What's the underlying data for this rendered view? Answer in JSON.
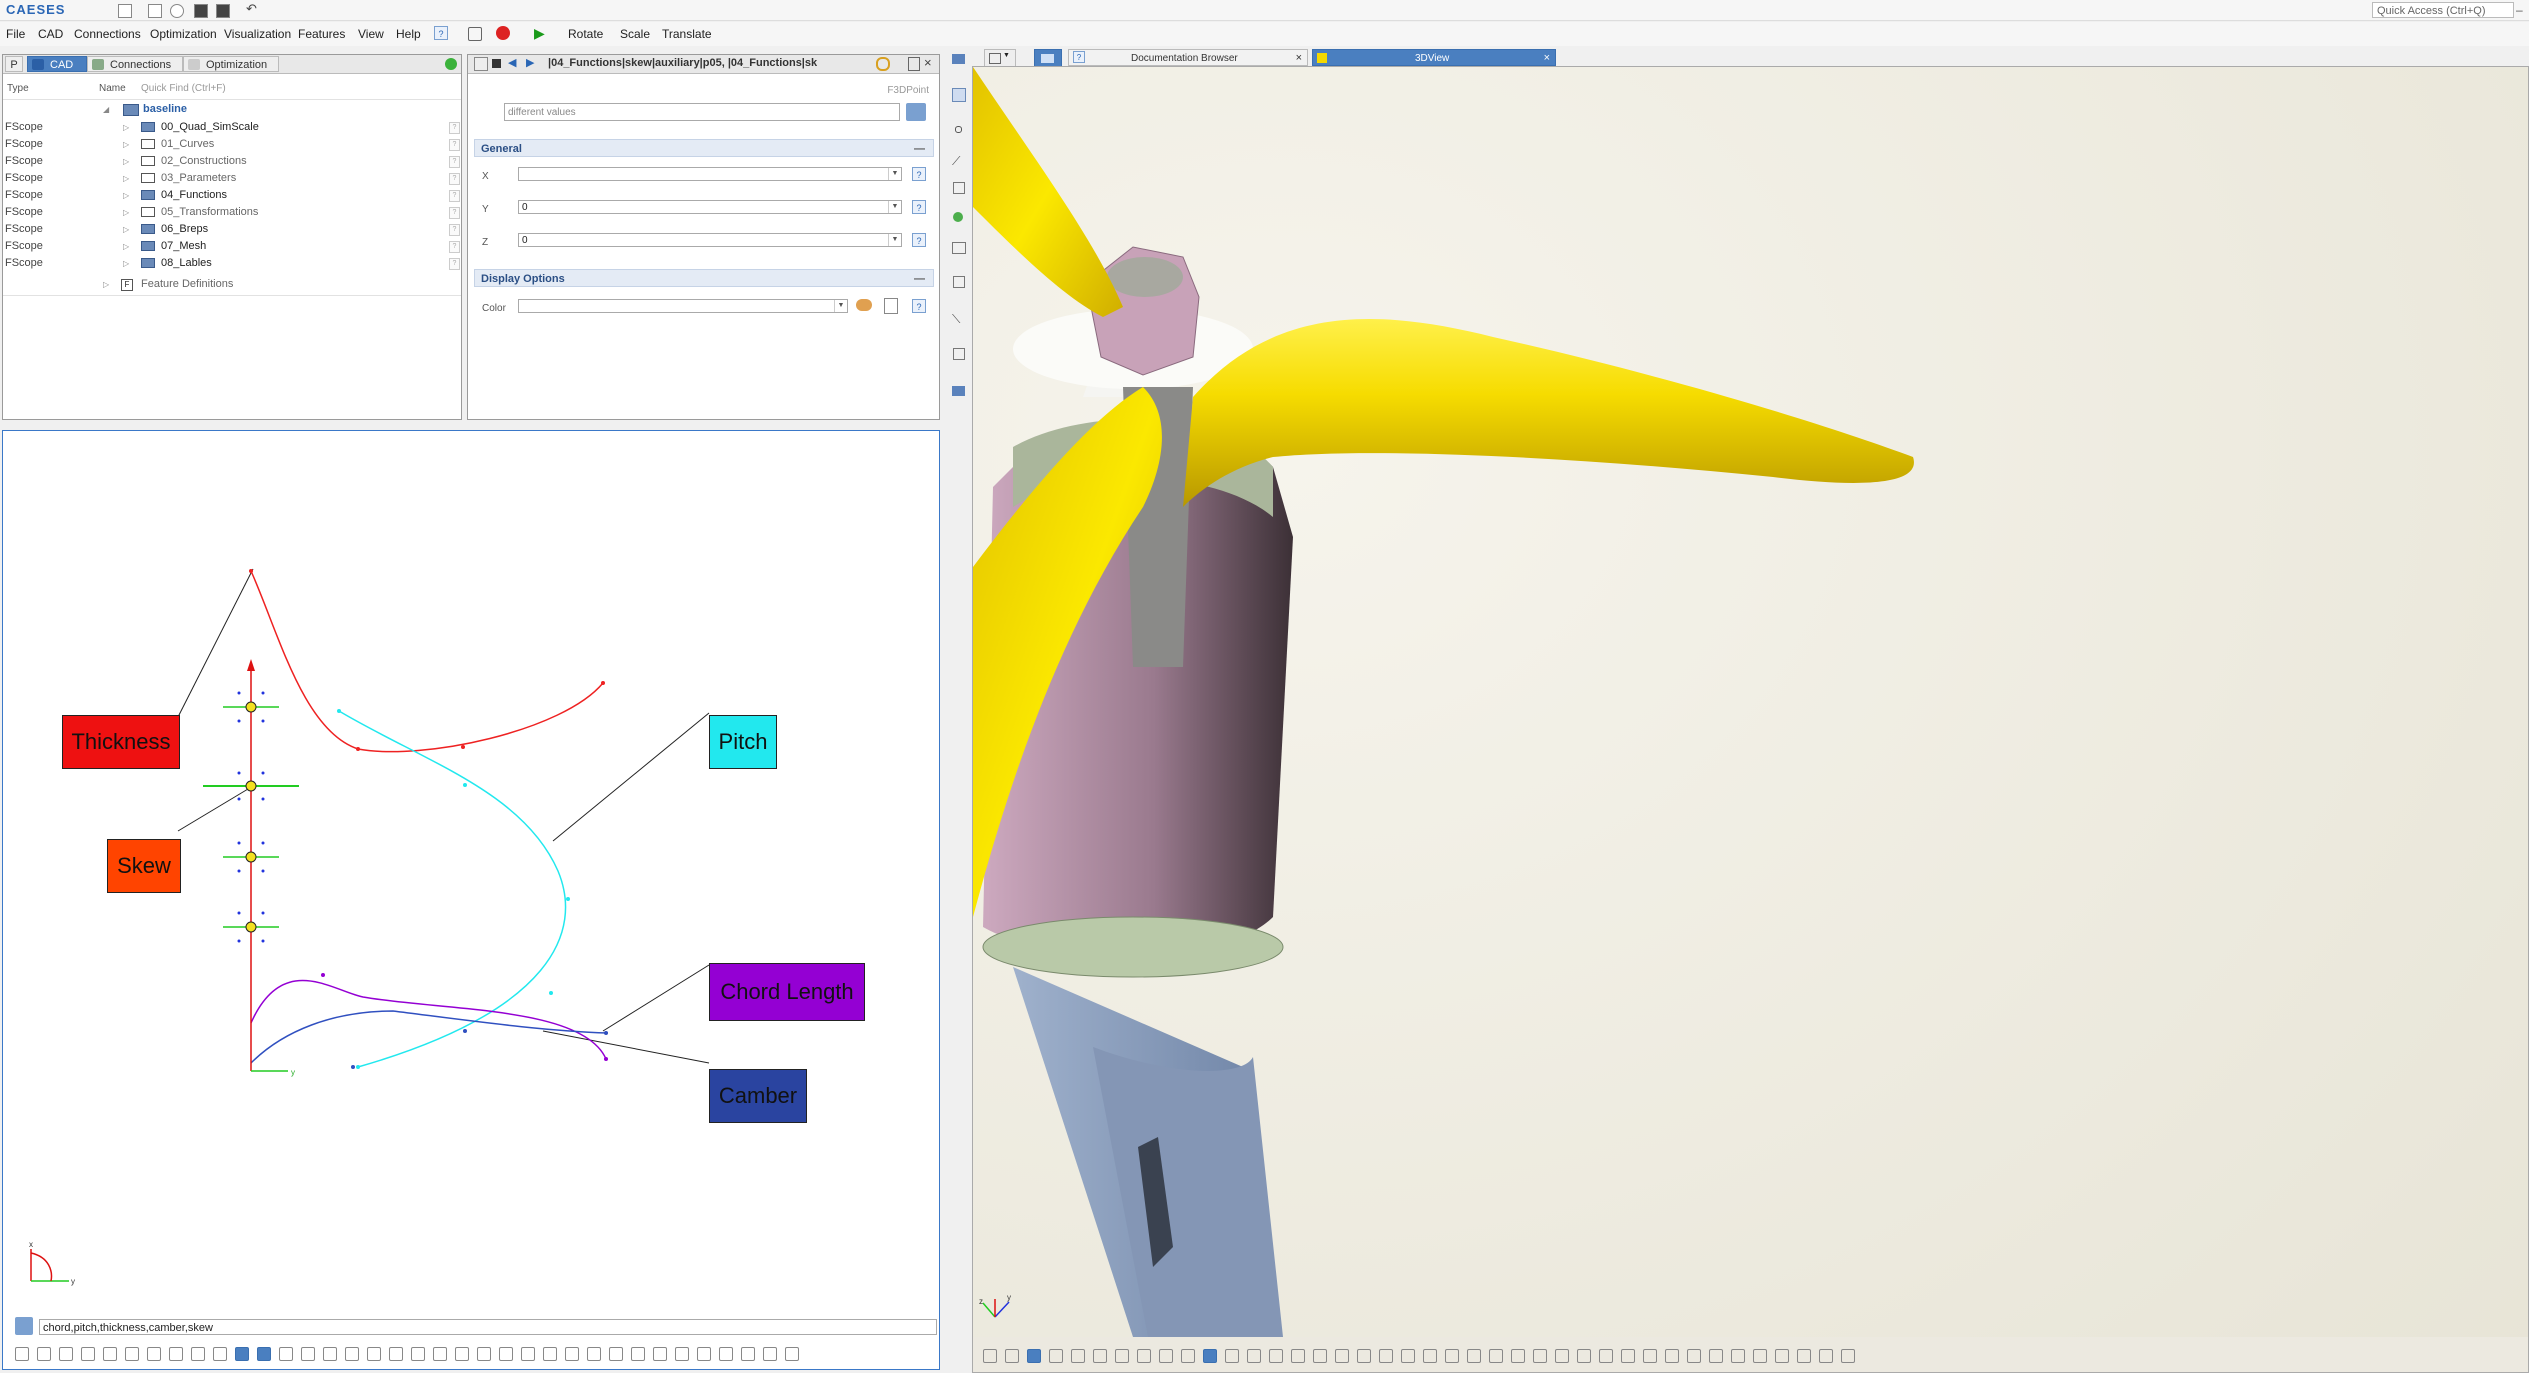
{
  "app": {
    "logo": "CAESES",
    "quick_access": "Quick Access (Ctrl+Q)"
  },
  "menu": [
    "File",
    "CAD",
    "Connections",
    "Optimization",
    "Visualization",
    "Features",
    "View",
    "Help"
  ],
  "toolbar": {
    "rotate": "Rotate",
    "scale": "Scale",
    "translate": "Translate"
  },
  "tree": {
    "tabs": [
      "P",
      "CAD",
      "Connections",
      "Optimization"
    ],
    "col_type": "Type",
    "col_name": "Name",
    "quick_find": "Quick Find (Ctrl+F)",
    "root": "baseline",
    "rows": [
      {
        "type": "FScope",
        "name": "00_Quad_SimScale",
        "filled": true,
        "dim": false
      },
      {
        "type": "FScope",
        "name": "01_Curves",
        "filled": false,
        "dim": true
      },
      {
        "type": "FScope",
        "name": "02_Constructions",
        "filled": false,
        "dim": true
      },
      {
        "type": "FScope",
        "name": "03_Parameters",
        "filled": false,
        "dim": true
      },
      {
        "type": "FScope",
        "name": "04_Functions",
        "filled": true,
        "dim": false
      },
      {
        "type": "FScope",
        "name": "05_Transformations",
        "filled": false,
        "dim": true
      },
      {
        "type": "FScope",
        "name": "06_Breps",
        "filled": true,
        "dim": false
      },
      {
        "type": "FScope",
        "name": "07_Mesh",
        "filled": true,
        "dim": false
      },
      {
        "type": "FScope",
        "name": "08_Lables",
        "filled": true,
        "dim": false
      }
    ],
    "feature_defs": "Feature Definitions"
  },
  "props": {
    "path": "|04_Functions|skew|auxiliary|p05, |04_Functions|sk",
    "type_label": "F3DPoint",
    "multi_value": "different values",
    "general": "General",
    "x_label": "X",
    "x_value": "",
    "y_label": "Y",
    "y_value": "0",
    "z_label": "Z",
    "z_value": "0",
    "display_options": "Display Options",
    "color_label": "Color",
    "color_value": "",
    "help": "?"
  },
  "sketch": {
    "command": "chord,pitch,thickness,camber,skew",
    "labels": {
      "thickness": "Thickness",
      "skew": "Skew",
      "pitch": "Pitch",
      "chord": "Chord Length",
      "camber": "Camber"
    },
    "axis_x": "x",
    "axis_y": "y",
    "axis_z": "z"
  },
  "view": {
    "tabs": [
      "Documentation Browser",
      "3DView"
    ],
    "close": "×"
  },
  "colors": {
    "accent": "#3a78c8",
    "thickness": "#ee1111",
    "skew": "#ff4400",
    "pitch": "#22e8ee",
    "chord": "#9400d3",
    "camber": "#2a44a0",
    "blade": "#f4d800",
    "hub": "#cfa8bf"
  }
}
